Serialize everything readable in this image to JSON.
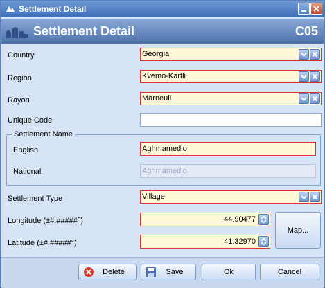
{
  "window": {
    "title": "Settlement Detail"
  },
  "header": {
    "title": "Settlement Detail",
    "code": "C05"
  },
  "fields": {
    "country": {
      "label": "Country",
      "value": "Georgia"
    },
    "region": {
      "label": "Region",
      "value": "Kvemo-Kartli"
    },
    "rayon": {
      "label": "Rayon",
      "value": "Marneuli"
    },
    "unique_code": {
      "label": "Unique Code",
      "value": ""
    },
    "settlement_name": {
      "group_label": "Settlement Name",
      "english_label": "English",
      "english_value": "Aghmamedlo",
      "national_label": "National",
      "national_value": "Aghmamedlo"
    },
    "settlement_type": {
      "label": "Settlement Type",
      "value": "Village"
    },
    "longitude": {
      "label": "Longitude (±#.#####°)",
      "value": "44.90477"
    },
    "latitude": {
      "label": "Latitude (±#.#####°)",
      "value": "41.32970"
    }
  },
  "buttons": {
    "map": "Map...",
    "delete": "Delete",
    "save": "Save",
    "ok": "Ok",
    "cancel": "Cancel"
  },
  "colors": {
    "required_border": "#e03030",
    "required_bg": "#fff8d8",
    "window_bg": "#d6e4f5",
    "header_bg": "#4d72ad"
  },
  "icons": [
    "app-icon",
    "minimize-icon",
    "close-icon",
    "header-settlement-icon",
    "dropdown-icon",
    "clear-icon",
    "spin-icon",
    "delete-icon",
    "save-icon"
  ]
}
